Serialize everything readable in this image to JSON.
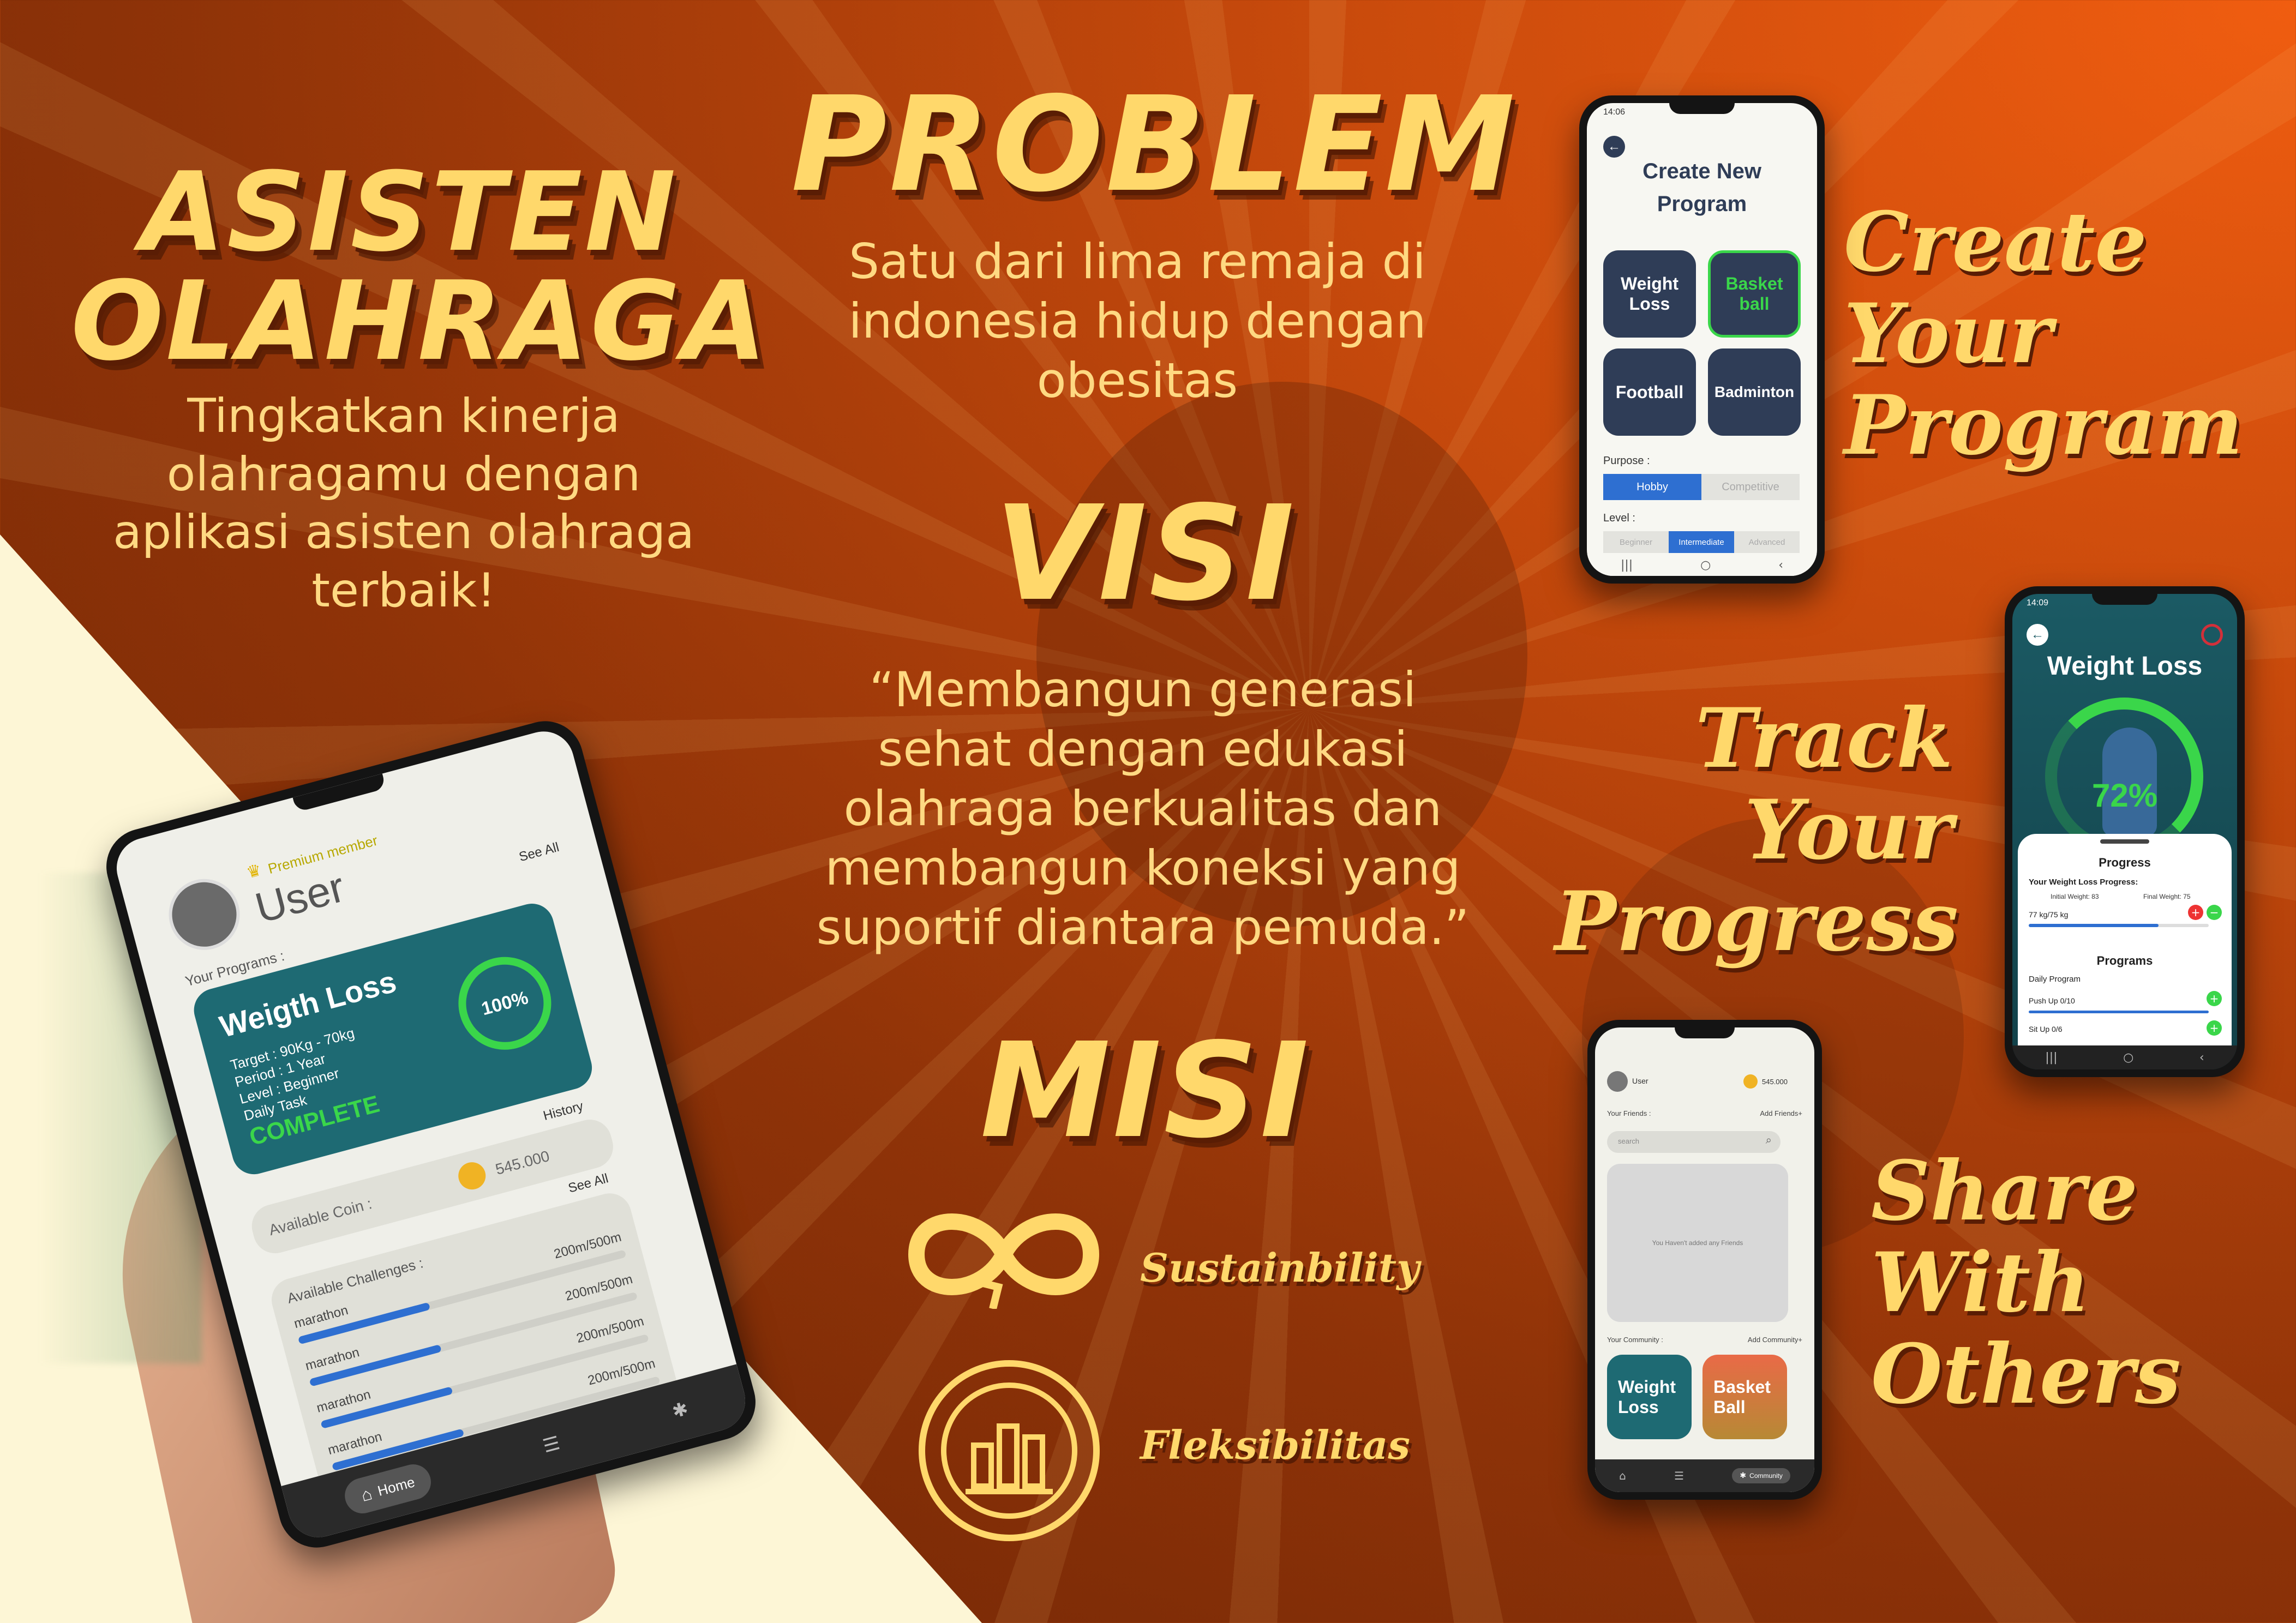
{
  "hero": {
    "title_line1": "ASISTEN",
    "title_line2": "OLAHRAGA",
    "tagline": "Tingkatkan kinerja olahragamu dengan aplikasi asisten olahraga terbaik!"
  },
  "problem": {
    "title": "PROBLEM",
    "text": "Satu dari lima remaja di indonesia hidup dengan obesitas"
  },
  "visi": {
    "title": "VISI",
    "text": "“Membangun generasi sehat dengan edukasi olahraga berkualitas dan membangun koneksi yang suportif diantara pemuda.”"
  },
  "misi": {
    "title": "MISI",
    "items": [
      {
        "label": "Sustainbility",
        "icon": "infinity-icon"
      },
      {
        "label": "Fleksibilitas",
        "icon": "bar-chart-icon"
      }
    ]
  },
  "features": {
    "create_line1": "Create",
    "create_line2": "Your",
    "create_line3": "Program",
    "track_line1": "Track",
    "track_line2": "Your",
    "track_line3": "Progress",
    "share_line1": "Share",
    "share_line2": "With",
    "share_line3": "Others"
  },
  "home_phone": {
    "premium": "Premium member",
    "user": "User",
    "see_all": "See All",
    "your_programs": "Your Programs :",
    "card_title": "Weigth Loss",
    "card_target": "Target : 90Kg - 70kg",
    "card_period": "Period : 1 Year",
    "card_level": "Level : Beginner",
    "card_daily": "Daily Task",
    "card_complete": "COMPLETE",
    "card_pct": "100%",
    "history": "History",
    "coin_label": "Available Coin :",
    "coin_value": "545.000",
    "challenges_label": "Available Challenges :",
    "challenges_see_all": "See All",
    "challenges": [
      {
        "name": "marathon",
        "value": "200m/500m"
      },
      {
        "name": "marathon",
        "value": "200m/500m"
      },
      {
        "name": "marathon",
        "value": "200m/500m"
      },
      {
        "name": "marathon",
        "value": "200m/500m"
      }
    ],
    "nav_home": "Home"
  },
  "create_phone": {
    "time": "14:06",
    "title_line1": "Create New",
    "title_line2": "Program",
    "tiles": [
      {
        "line1": "Weight",
        "line2": "Loss"
      },
      {
        "line1": "Basket",
        "line2": "ball"
      },
      {
        "line1": "Football",
        "line2": ""
      },
      {
        "line1": "Badminton",
        "line2": ""
      }
    ],
    "purpose_label": "Purpose :",
    "purpose_options": [
      "Hobby",
      "Competitive"
    ],
    "level_label": "Level :",
    "level_options": [
      "Beginner",
      "Intermediate",
      "Advanced"
    ]
  },
  "track_phone": {
    "time": "14:09",
    "title": "Weight Loss",
    "percent": "72%",
    "progress_title": "Progress",
    "progress_label": "Your Weight Loss Progress:",
    "initial": "Initial Weight: 83",
    "final": "Final Weight: 75",
    "current": "77 kg/75 kg",
    "progress_fraction": 0.72,
    "programs_title": "Programs",
    "daily_label": "Daily Program",
    "tasks": [
      {
        "name": "Push Up 0/10",
        "fraction": 0
      },
      {
        "name": "Sit Up 0/6",
        "fraction": 0
      }
    ]
  },
  "share_phone": {
    "user": "User",
    "coin": "545.000",
    "friends_label": "Your Friends :",
    "add_friends": "Add Friends+",
    "search_placeholder": "search",
    "empty_text": "You Haven't added any Friends",
    "community_label": "Your Community :",
    "add_community": "Add Community+",
    "communities": [
      {
        "line1": "Weight",
        "line2": "Loss"
      },
      {
        "line1": "Basket",
        "line2": "Ball"
      }
    ],
    "nav_community": "Community"
  },
  "colors": {
    "accent_yellow": "#ffd86b",
    "orange": "#d4530d",
    "navy_tile": "#2f3d57",
    "blue": "#2e6fd1",
    "green": "#3ad64a",
    "teal": "#1e6a73"
  }
}
